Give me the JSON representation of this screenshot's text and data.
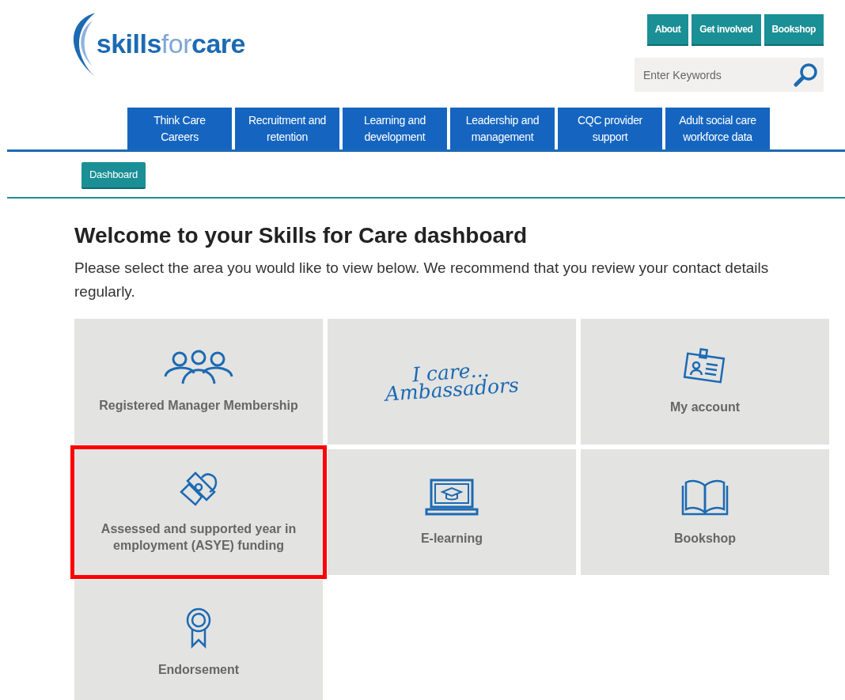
{
  "logo": {
    "parts": [
      "skills",
      "for",
      "care"
    ]
  },
  "top_links": [
    "About",
    "Get involved",
    "Bookshop"
  ],
  "search": {
    "placeholder": "Enter Keywords"
  },
  "nav_tabs": [
    {
      "lines": [
        "Think Care",
        "Careers"
      ]
    },
    {
      "lines": [
        "Recruitment and",
        "retention"
      ]
    },
    {
      "lines": [
        "Learning and",
        "development"
      ]
    },
    {
      "lines": [
        "Leadership and",
        "management"
      ]
    },
    {
      "lines": [
        "CQC provider",
        "support"
      ]
    },
    {
      "lines": [
        "Adult social care",
        "workforce data"
      ]
    }
  ],
  "breadcrumb": {
    "label": "Dashboard"
  },
  "heading": "Welcome to your Skills for Care dashboard",
  "intro": "Please select the area you would like to view below. We recommend that you review your contact details regularly.",
  "tiles": [
    {
      "kind": "icon",
      "label": "Registered Manager Membership",
      "highlighted": false
    },
    {
      "kind": "logo",
      "logo_lines": [
        "I care...",
        "Ambassadors"
      ],
      "highlighted": false
    },
    {
      "kind": "icon",
      "label": "My account",
      "highlighted": false
    },
    {
      "kind": "icon",
      "label": "Assessed and supported year in employment (ASYE) funding",
      "highlighted": true
    },
    {
      "kind": "icon",
      "label": "E-learning",
      "highlighted": false
    },
    {
      "kind": "icon",
      "label": "Bookshop",
      "highlighted": false
    },
    {
      "kind": "icon",
      "label": "Endorsement",
      "highlighted": false
    }
  ]
}
